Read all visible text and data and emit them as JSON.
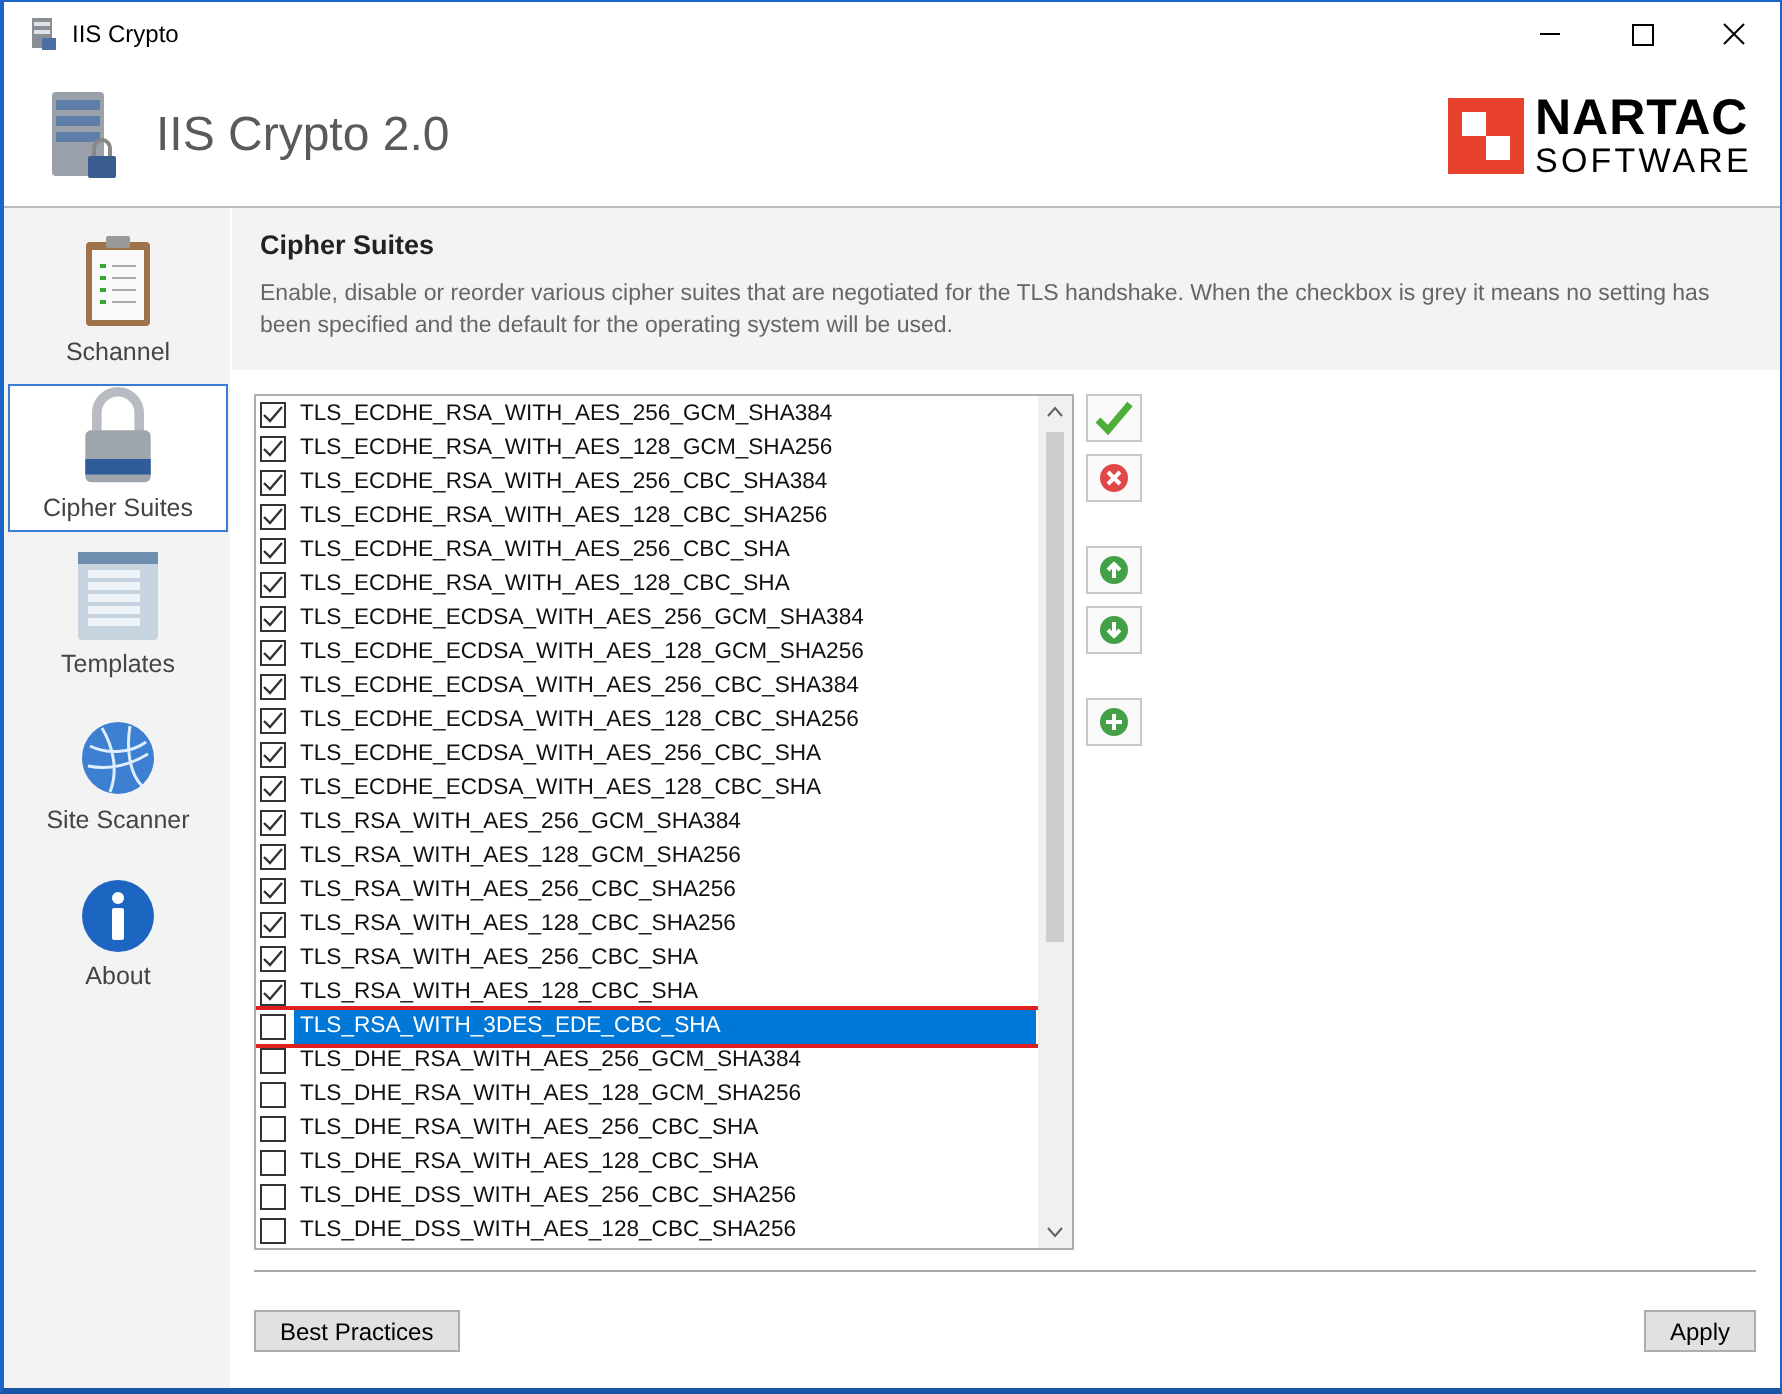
{
  "window": {
    "title": "IIS Crypto"
  },
  "header": {
    "app_name": "IIS Crypto 2.0",
    "logo_top": "NARTAC",
    "logo_bottom": "SOFTWARE"
  },
  "sidebar": {
    "items": [
      {
        "label": "Schannel",
        "kind": "clipboard",
        "selected": false
      },
      {
        "label": "Cipher Suites",
        "kind": "lock",
        "selected": true
      },
      {
        "label": "Templates",
        "kind": "list",
        "selected": false
      },
      {
        "label": "Site Scanner",
        "kind": "globe",
        "selected": false
      },
      {
        "label": "About",
        "kind": "info",
        "selected": false
      }
    ]
  },
  "section": {
    "title": "Cipher Suites",
    "description": "Enable, disable or reorder various cipher suites that are negotiated for the TLS handshake. When the checkbox is grey it means no setting has been specified and the default for the operating system will be used."
  },
  "cipher_list": {
    "rows": [
      {
        "label": "TLS_ECDHE_RSA_WITH_AES_256_GCM_SHA384",
        "checked": true,
        "selected": false,
        "marked": false
      },
      {
        "label": "TLS_ECDHE_RSA_WITH_AES_128_GCM_SHA256",
        "checked": true,
        "selected": false,
        "marked": false
      },
      {
        "label": "TLS_ECDHE_RSA_WITH_AES_256_CBC_SHA384",
        "checked": true,
        "selected": false,
        "marked": false
      },
      {
        "label": "TLS_ECDHE_RSA_WITH_AES_128_CBC_SHA256",
        "checked": true,
        "selected": false,
        "marked": false
      },
      {
        "label": "TLS_ECDHE_RSA_WITH_AES_256_CBC_SHA",
        "checked": true,
        "selected": false,
        "marked": false
      },
      {
        "label": "TLS_ECDHE_RSA_WITH_AES_128_CBC_SHA",
        "checked": true,
        "selected": false,
        "marked": false
      },
      {
        "label": "TLS_ECDHE_ECDSA_WITH_AES_256_GCM_SHA384",
        "checked": true,
        "selected": false,
        "marked": false
      },
      {
        "label": "TLS_ECDHE_ECDSA_WITH_AES_128_GCM_SHA256",
        "checked": true,
        "selected": false,
        "marked": false
      },
      {
        "label": "TLS_ECDHE_ECDSA_WITH_AES_256_CBC_SHA384",
        "checked": true,
        "selected": false,
        "marked": false
      },
      {
        "label": "TLS_ECDHE_ECDSA_WITH_AES_128_CBC_SHA256",
        "checked": true,
        "selected": false,
        "marked": false
      },
      {
        "label": "TLS_ECDHE_ECDSA_WITH_AES_256_CBC_SHA",
        "checked": true,
        "selected": false,
        "marked": false
      },
      {
        "label": "TLS_ECDHE_ECDSA_WITH_AES_128_CBC_SHA",
        "checked": true,
        "selected": false,
        "marked": false
      },
      {
        "label": "TLS_RSA_WITH_AES_256_GCM_SHA384",
        "checked": true,
        "selected": false,
        "marked": false
      },
      {
        "label": "TLS_RSA_WITH_AES_128_GCM_SHA256",
        "checked": true,
        "selected": false,
        "marked": false
      },
      {
        "label": "TLS_RSA_WITH_AES_256_CBC_SHA256",
        "checked": true,
        "selected": false,
        "marked": false
      },
      {
        "label": "TLS_RSA_WITH_AES_128_CBC_SHA256",
        "checked": true,
        "selected": false,
        "marked": false
      },
      {
        "label": "TLS_RSA_WITH_AES_256_CBC_SHA",
        "checked": true,
        "selected": false,
        "marked": false
      },
      {
        "label": "TLS_RSA_WITH_AES_128_CBC_SHA",
        "checked": true,
        "selected": false,
        "marked": false
      },
      {
        "label": "TLS_RSA_WITH_3DES_EDE_CBC_SHA",
        "checked": false,
        "selected": true,
        "marked": true
      },
      {
        "label": "TLS_DHE_RSA_WITH_AES_256_GCM_SHA384",
        "checked": false,
        "selected": false,
        "marked": false
      },
      {
        "label": "TLS_DHE_RSA_WITH_AES_128_GCM_SHA256",
        "checked": false,
        "selected": false,
        "marked": false
      },
      {
        "label": "TLS_DHE_RSA_WITH_AES_256_CBC_SHA",
        "checked": false,
        "selected": false,
        "marked": false
      },
      {
        "label": "TLS_DHE_RSA_WITH_AES_128_CBC_SHA",
        "checked": false,
        "selected": false,
        "marked": false
      },
      {
        "label": "TLS_DHE_DSS_WITH_AES_256_CBC_SHA256",
        "checked": false,
        "selected": false,
        "marked": false
      },
      {
        "label": "TLS_DHE_DSS_WITH_AES_128_CBC_SHA256",
        "checked": false,
        "selected": false,
        "marked": false
      }
    ]
  },
  "tools": [
    {
      "kind": "check"
    },
    {
      "kind": "remove"
    },
    {
      "kind": "up"
    },
    {
      "kind": "down"
    },
    {
      "kind": "add"
    }
  ],
  "buttons": {
    "left": "Best Practices",
    "right": "Apply"
  }
}
